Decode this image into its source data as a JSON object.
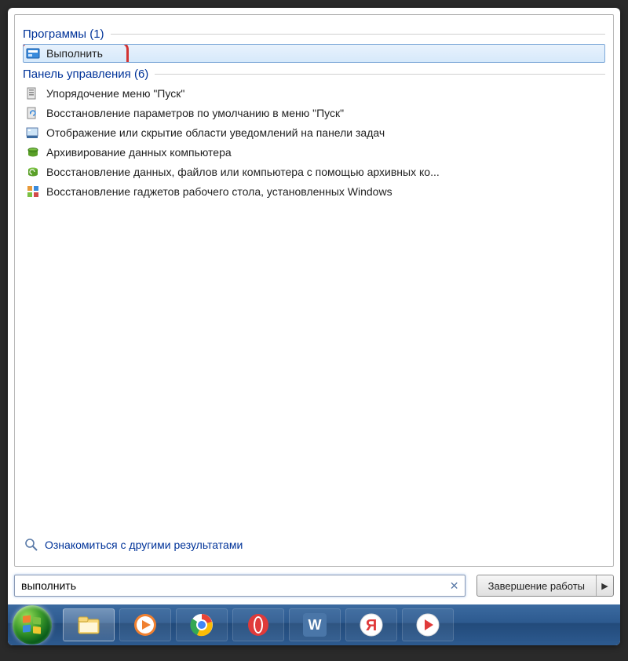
{
  "sections": {
    "programs": {
      "label": "Программы (1)"
    },
    "controlPanel": {
      "label": "Панель управления (6)"
    }
  },
  "programItems": [
    {
      "label": "Выполнить"
    }
  ],
  "controlPanelItems": [
    {
      "label": "Упорядочение меню \"Пуск\""
    },
    {
      "label": "Восстановление параметров по умолчанию в меню \"Пуск\""
    },
    {
      "label": "Отображение или скрытие области уведомлений на панели задач"
    },
    {
      "label": "Архивирование данных компьютера"
    },
    {
      "label": "Восстановление данных, файлов или компьютера с помощью архивных ко..."
    },
    {
      "label": "Восстановление гаджетов рабочего стола, установленных Windows"
    }
  ],
  "moreResults": {
    "label": "Ознакомиться с другими результатами"
  },
  "search": {
    "value": "выполнить"
  },
  "shutdown": {
    "label": "Завершение работы"
  }
}
